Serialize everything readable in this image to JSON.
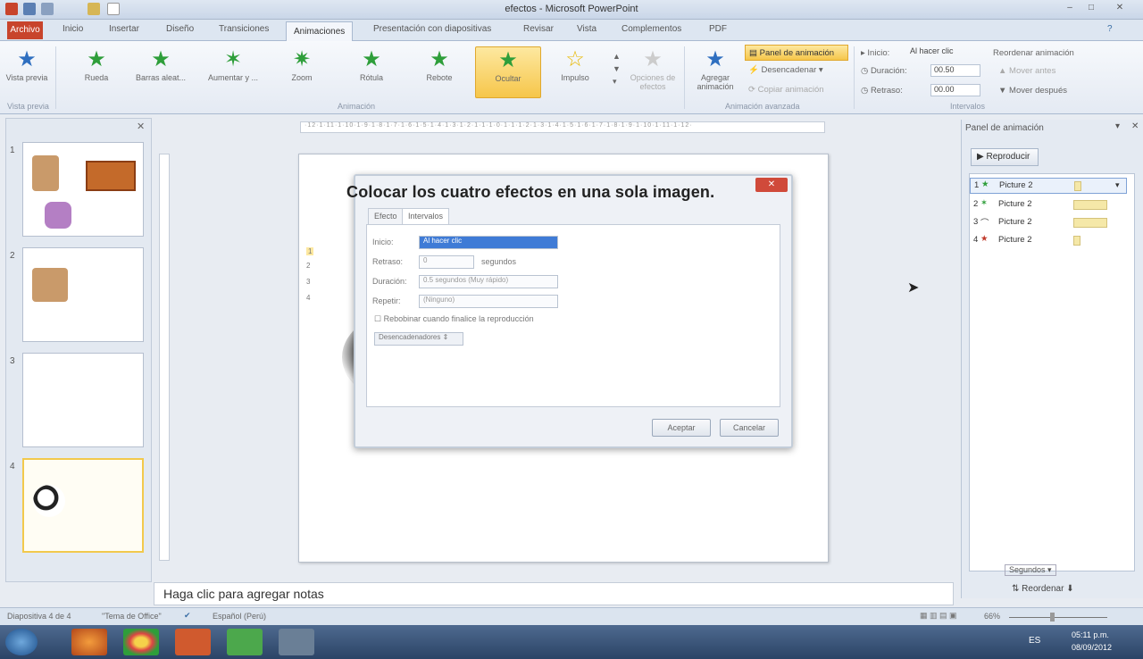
{
  "window": {
    "title": "efectos - Microsoft PowerPoint"
  },
  "tabs": [
    {
      "label": "Archivo"
    },
    {
      "label": "Inicio"
    },
    {
      "label": "Insertar"
    },
    {
      "label": "Diseño"
    },
    {
      "label": "Transiciones"
    },
    {
      "label": "Animaciones"
    },
    {
      "label": "Presentación con diapositivas"
    },
    {
      "label": "Revisar"
    },
    {
      "label": "Vista"
    },
    {
      "label": "Complementos"
    },
    {
      "label": "PDF"
    }
  ],
  "ribbon": {
    "preview_label": "Vista previa",
    "preview_group": "Vista previa",
    "effects": [
      "Rueda",
      "Barras aleat...",
      "Aumentar y ...",
      "Zoom",
      "Rótula",
      "Rebote",
      "Ocultar",
      "Impulso"
    ],
    "effect_options": "Opciones de efectos",
    "animation_group": "Animación",
    "add_animation": "Agregar animación",
    "panel_button": "Panel de animación",
    "trigger_button": "Desencadenar",
    "copy_button": "Copiar animación",
    "advanced_group": "Animación avanzada",
    "start_label": "Inicio:",
    "start_value": "Al hacer clic",
    "duration_label": "Duración:",
    "duration_value": "00.50",
    "delay_label": "Retraso:",
    "delay_value": "00.00",
    "reorder_label": "Reordenar animación",
    "move_earlier": "Mover antes",
    "move_later": "Mover después",
    "timing_group": "Intervalos"
  },
  "slides": [
    {
      "num": "1"
    },
    {
      "num": "2"
    },
    {
      "num": "3"
    },
    {
      "num": "4"
    }
  ],
  "dialog": {
    "tab_effect": "Efecto",
    "tab_timing": "Intervalos",
    "start_label": "Inicio:",
    "start_value": "Al hacer clic",
    "delay_label": "Retraso:",
    "delay_value": "0",
    "delay_unit": "segundos",
    "duration_label": "Duración:",
    "duration_value": "0.5 segundos (Muy rápido)",
    "repeat_label": "Repetir:",
    "repeat_value": "(Ninguno)",
    "rewind_label": "Rebobinar cuando finalice la reproducción",
    "triggers_button": "Desencadenadores",
    "ok_button": "Aceptar",
    "cancel_button": "Cancelar"
  },
  "slide_caption": "Colocar los cuatro efectos en una sola imagen.",
  "anim_numbers": [
    "1",
    "2",
    "3",
    "4"
  ],
  "anim_pane": {
    "title": "Panel de animación",
    "play_button": "Reproducir",
    "items": [
      {
        "num": "1",
        "name": "Picture 2"
      },
      {
        "num": "2",
        "name": "Picture 2"
      },
      {
        "num": "3",
        "name": "Picture 2"
      },
      {
        "num": "4",
        "name": "Picture 2"
      }
    ],
    "seconds_label": "Segundos",
    "reorder_label": "Reordenar"
  },
  "notes_placeholder": "Haga clic para agregar notas",
  "status": {
    "slide_info": "Diapositiva 4 de 4",
    "theme": "\"Tema de Office\"",
    "language": "Español (Perú)",
    "zoom": "66%"
  },
  "taskbar": {
    "time": "05:11 p.m.",
    "date": "08/09/2012",
    "lang": "ES"
  },
  "ruler_marks": "·12·1·11·1·10·1·9·1·8·1·7·1·6·1·5·1·4·1·3·1·2·1·1·1·0·1·1·1·2·1·3·1·4·1·5·1·6·1·7·1·8·1·9·1·10·1·11·1·12·"
}
